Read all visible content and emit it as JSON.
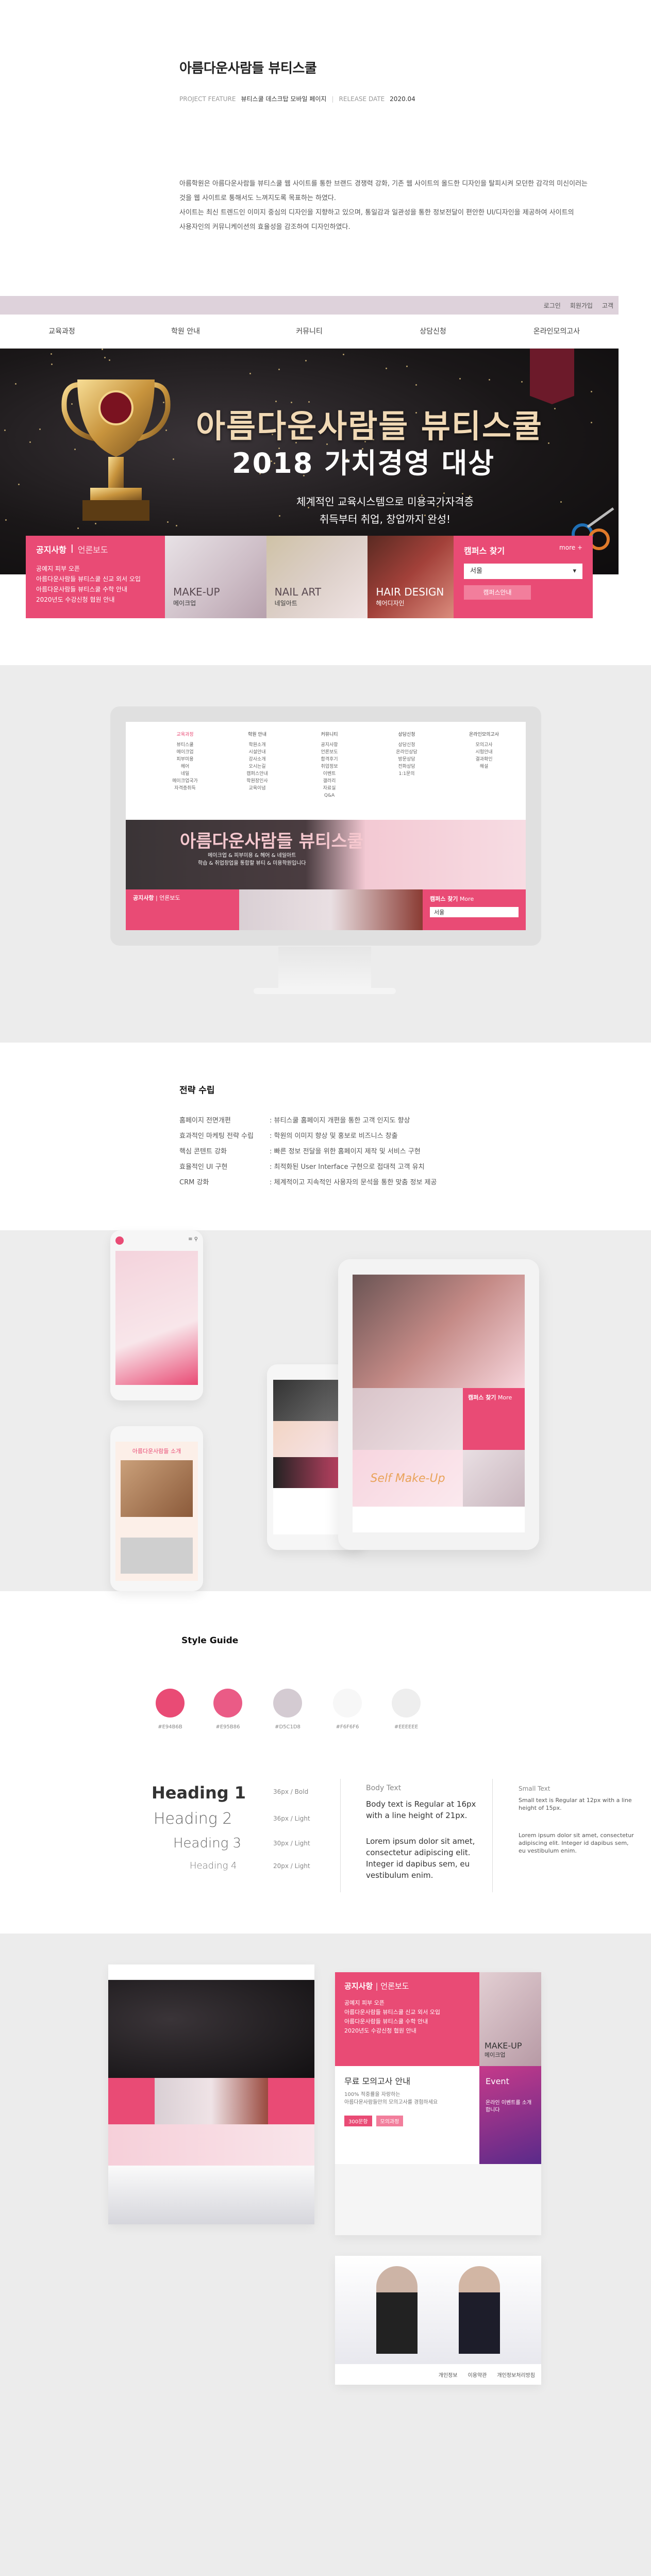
{
  "header": {
    "title": "아름다운사람들 뷰티스쿨",
    "feature_label": "PROJECT FEATURE",
    "feature_value": "뷰티스쿨 데스크탑 모바일 페이지",
    "release_label": "RELEASE DATE",
    "release_value": "2020.04",
    "desc": [
      "아름학원은 아름다운사람들 뷰티스쿨 웹 사이트를 통한 브랜드 경쟁력 강화, 기존 웹 사이트의 올드한 디자인을 탈피시켜 모던한 감각의 미신이러는",
      "것을 웹 사이트로 통해서도 느껴지도록 목표하는 하였다.",
      "사이트는 최신 트렌드인 이미지 중심의 디자인을 지향하고 있으며, 통일감과 일관성을 통한 정보전달이 편안한 UI/디자인을 제공하여 사이트의",
      "사용자인의 커뮤니케이션의 효율성을 감조하여 디자인하였다."
    ]
  },
  "site": {
    "top_links": [
      "로그인",
      "회원가입",
      "고객"
    ],
    "gnb": [
      "교육과정",
      "학원 안내",
      "커뮤니티",
      "상담신청",
      "온라인모의고사"
    ],
    "hero_title_1": "아름다운사람들 뷰티스쿨",
    "hero_title_2": "2018 가치경영 대상",
    "hero_sub_1": "체계적인 교육시스템으로 미용국가자격증",
    "hero_sub_2": "취득부터 취업, 창업까지 완성!",
    "notice_tab_on": "공지사항",
    "notice_tab_off": "언론보도",
    "notice_items": [
      "공예지 피부 오픈",
      "아름다운사람들 뷰티스쿨 신교 외서 오입",
      "아름다운사람들 뷰티스쿨 수학 안내",
      "2020년도 수강신청 협원 안내"
    ],
    "promo": [
      {
        "title": "MAKE-UP",
        "sub": "메이크업"
      },
      {
        "title": "NAIL ART",
        "sub": "네일아트"
      },
      {
        "title": "HAIR DESIGN",
        "sub": "헤어디자인"
      }
    ],
    "campus_title": "캠퍼스 찾기",
    "campus_more": "more +",
    "campus_select": "서울",
    "campus_button": "캠퍼스안내"
  },
  "monitor": {
    "nav": [
      "교육과정",
      "학원 안내",
      "커뮤니티",
      "상담신청",
      "온라인모의고사"
    ],
    "hero_title": "아름다운사람들 뷰티스쿨",
    "hero_sub": "메이크업 & 피부미용 & 헤어 & 네일아트\n학습 & 취업창업을 통합할 뷰티 & 미용학원입니다",
    "notice_on": "공지사항",
    "notice_off": "언론보도",
    "campus": "캠퍼스 찾기",
    "campus_more": "More",
    "campus_sel": "서울"
  },
  "strategy": {
    "title": "전략 수립",
    "rows": [
      {
        "k": "홈페이지 전면개편",
        "v": ": 뷰티스쿨 홈페이지 개편을 통한 고객 인지도 향상"
      },
      {
        "k": "효과적인 마케팅 전략 수립",
        "v": ": 학원의 이미지 향상 및 홍보로 비즈니스 창출"
      },
      {
        "k": "핵심 콘텐트 강화",
        "v": ": 빠른 정보 전달을 위한 홈페이지 제작 및 서비스 구현"
      },
      {
        "k": "효율적인 UI 구현",
        "v": ": 최적화된 User Interface 구현으로 접대적 고객 유치"
      },
      {
        "k": "CRM 강화",
        "v": ": 체계적이고 지속적인 사용자의 문석을 통한 맞춤 정보 제공"
      }
    ]
  },
  "devices": {
    "mobile_title": "아름다운사람들 소개",
    "tablet_campus": "캠퍼스 찾기",
    "tablet_more": "More",
    "self_make": "Self Make-Up"
  },
  "style_guide": {
    "title": "Style Guide",
    "colors": [
      {
        "hex": "#e94b75",
        "label": "#E94B6B"
      },
      {
        "hex": "#ea5b86",
        "label": "#E95B86"
      },
      {
        "hex": "#d4cbd2",
        "label": "#D5C1D8"
      },
      {
        "hex": "#f7f7f7",
        "label": "#F6F6F6"
      },
      {
        "hex": "#eeeeee",
        "label": "#EEEEEE"
      }
    ],
    "headings": [
      {
        "name": "Heading 1",
        "spec": "36px  /  Bold"
      },
      {
        "name": "Heading 2",
        "spec": "36px  /  Light"
      },
      {
        "name": "Heading 3",
        "spec": "30px  /  Light"
      },
      {
        "name": "Heading 4",
        "spec": "20px  /  Light"
      }
    ],
    "body_label": "Body Text",
    "body_spec": "Body text is Regular at 16px with a line height of 21px.",
    "body_lorem": "Lorem ipsum dolor sit amet, consectetur adipiscing elit. Integer id dapibus sem, eu vestibulum enim.",
    "small_label": "Small Text",
    "small_spec": "Small text is Regular at 12px with a line height of 15px.",
    "small_lorem": "Lorem ipsum dolor sit amet, consectetur adipiscing elit. Integer id dapibus sem, eu vestibulum enim."
  },
  "bottom": {
    "notice_on": "공지사항",
    "notice_off": "언론보도",
    "notice_items": [
      "공예지 피부 오픈",
      "아름다운사람들 뷰티스쿨 신교 외서 오입",
      "아름다운사람들 뷰티스쿨 수학 안내",
      "2020년도 수강신청 협원 안내"
    ],
    "makeup": "MAKE-UP",
    "makeup_sub": "메이크업",
    "exam_title": "무료 모의고사 안내",
    "exam_line_1": "100% 적중률을 자랑하는",
    "exam_line_2": "아름다운사람들만의 모의고사를 경험하세요",
    "exam_btn_1": "300문항",
    "exam_btn_2": "모의과정",
    "event": "Event",
    "event_sub": "온라인 이벤트를 소개합니다",
    "footer_links": [
      "개인정보",
      "이용약관",
      "개인정보처리방침"
    ]
  }
}
